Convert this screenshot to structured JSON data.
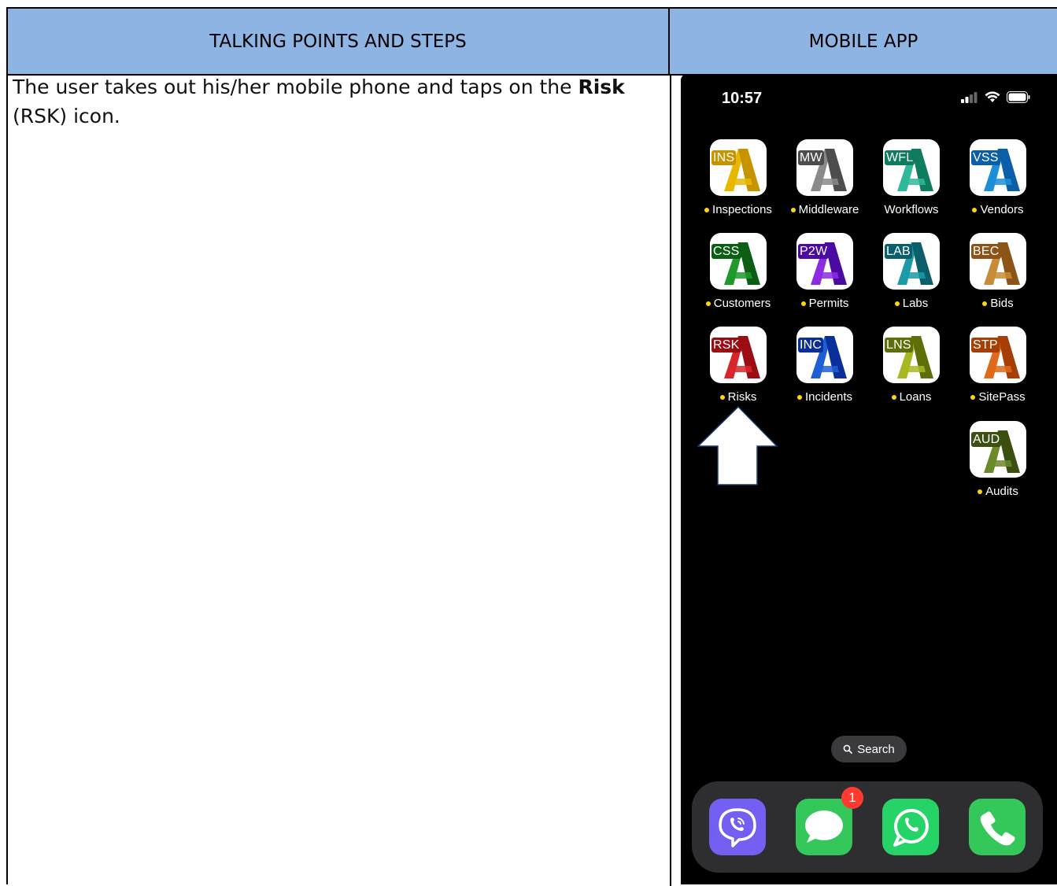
{
  "table": {
    "header_left": "TALKING POINTS AND STEPS",
    "header_right": "MOBILE APP",
    "step_text_before": "The user takes out his/her mobile phone and taps on the ",
    "step_text_bold": "Risk",
    "step_text_after": " (RSK) icon."
  },
  "phone": {
    "time": "10:57",
    "status_icons": [
      "signal-icon",
      "wifi-icon",
      "battery-icon"
    ],
    "apps": [
      {
        "code": "INS",
        "label": "Inspections",
        "dot": true,
        "color": "#e8b800",
        "dark": "#c79400"
      },
      {
        "code": "MW",
        "label": "Middleware",
        "dot": true,
        "color": "#8a8a8a",
        "dark": "#4d4d4d"
      },
      {
        "code": "WFL",
        "label": "Workflows",
        "dot": false,
        "color": "#2fb99a",
        "dark": "#0f7b5f"
      },
      {
        "code": "VSS",
        "label": "Vendors",
        "dot": true,
        "color": "#1e8ed8",
        "dark": "#0a5fa8"
      },
      {
        "code": "CSS",
        "label": "Customers",
        "dot": true,
        "color": "#1f9a2a",
        "dark": "#0b5e14"
      },
      {
        "code": "P2W",
        "label": "Permits",
        "dot": true,
        "color": "#8b2be2",
        "dark": "#4b0aa0"
      },
      {
        "code": "LAB",
        "label": "Labs",
        "dot": true,
        "color": "#1b9aa8",
        "dark": "#0b5f6b"
      },
      {
        "code": "BEC",
        "label": "Bids",
        "dot": true,
        "color": "#c98c36",
        "dark": "#8a5516"
      },
      {
        "code": "RSK",
        "label": "Risks",
        "dot": true,
        "color": "#d9262a",
        "dark": "#9b0d12"
      },
      {
        "code": "INC",
        "label": "Incidents",
        "dot": true,
        "color": "#1f5fd6",
        "dark": "#0a2f9a"
      },
      {
        "code": "LNS",
        "label": "Loans",
        "dot": true,
        "color": "#a8b820",
        "dark": "#5f6e08"
      },
      {
        "code": "STP",
        "label": "SitePass",
        "dot": true,
        "color": "#e0691a",
        "dark": "#a63f06"
      },
      {
        "code": "AUD",
        "label": "Audits",
        "dot": true,
        "color": "#6b8a2a",
        "dark": "#3a4f10"
      }
    ],
    "search_label": "Search",
    "dock": [
      {
        "name": "viber-app",
        "color": "#7360f2"
      },
      {
        "name": "messages-app",
        "color": "#34c759"
      },
      {
        "name": "whatsapp-app",
        "color": "#25d366"
      },
      {
        "name": "phone-app",
        "color": "#34c759"
      }
    ],
    "messages_badge": "1"
  }
}
